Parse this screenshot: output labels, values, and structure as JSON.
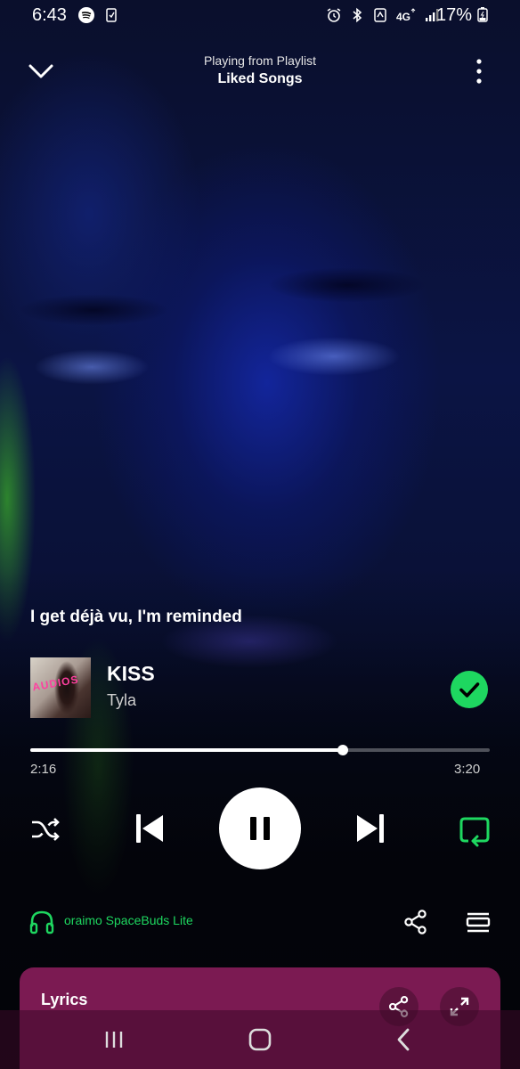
{
  "status_bar": {
    "time": "6:43",
    "battery": "17%",
    "network": "4G",
    "icons_left": [
      "spotify-icon",
      "sim-icon"
    ],
    "icons_right": [
      "alarm-icon",
      "bluetooth-icon",
      "data-saver-icon",
      "4g-icon",
      "signal-icon",
      "battery-icon"
    ]
  },
  "header": {
    "subtitle": "Playing from Playlist",
    "title": "Liked Songs"
  },
  "lyric_preview": "I get déjà vu, I'm reminded",
  "track": {
    "title": "KISS",
    "artist": "Tyla",
    "liked": true,
    "album_art_text": "AUDIOS"
  },
  "progress": {
    "elapsed": "2:16",
    "total": "3:20",
    "fraction": 0.68
  },
  "controls": {
    "shuffle": "shuffle-icon",
    "previous": "skip-previous-icon",
    "play_state": "pause-icon",
    "next": "skip-next-icon",
    "repeat": "repeat-icon"
  },
  "device": {
    "name": "oraimo SpaceBuds Lite"
  },
  "lyrics_card": {
    "title": "Lyrics"
  },
  "colors": {
    "accent": "#1ed760",
    "lyrics_card": "#7b1a52",
    "background": "#0b1444"
  }
}
